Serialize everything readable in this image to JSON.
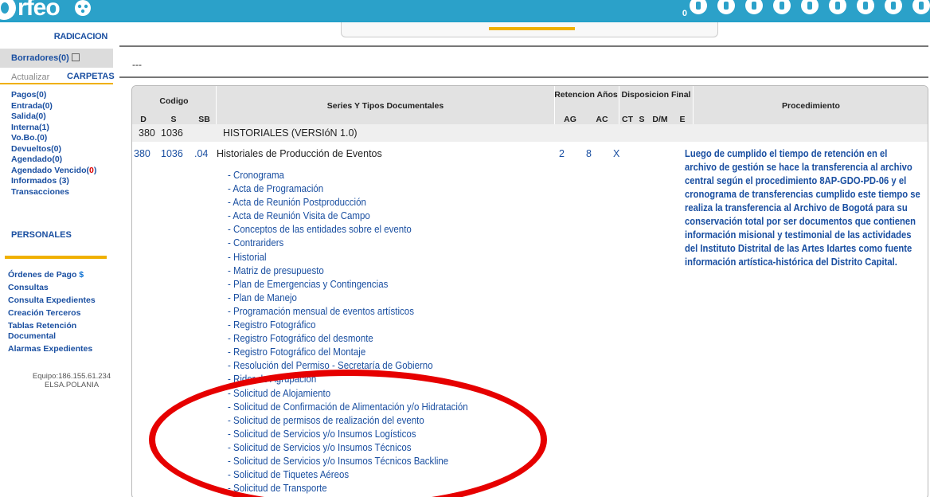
{
  "app": {
    "logo_text": "rfeo",
    "notification_count": "0"
  },
  "sidebar": {
    "radicacion": "RADICACION",
    "borradores": "Borradores(0)",
    "actualizar": "Actualizar",
    "carpetas": "CARPETAS",
    "folders": [
      "Pagos(0)",
      "Entrada(0)",
      "Salida(0)",
      "Interna(1)",
      "Vo.Bo.(0)",
      "Devueltos(0)",
      "Agendado(0)",
      "Agendado Vencido(",
      "Informados (3)",
      "Transacciones"
    ],
    "agendado_vencido_count": "0",
    "agendado_vencido_close": ")",
    "personales": "PERSONALES",
    "tools": [
      "Órdenes de Pago",
      "Consultas",
      "Consulta Expedientes",
      "Creación Terceros",
      "Tablas Retención Documental",
      "Alarmas Expedientes"
    ],
    "ordenes_symbol": "$",
    "equipo": "Equipo:186.155.61.234",
    "user": "ELSA.POLANIA"
  },
  "main": {
    "dashes": "---"
  },
  "table": {
    "headers": {
      "codigo": "Codigo",
      "d": "D",
      "s": "S",
      "sb": "SB",
      "series": "Series Y Tipos Documentales",
      "retencion": "Retencion Años",
      "ag": "AG",
      "ac": "AC",
      "disposicion": "Disposicion Final",
      "ct": "CT",
      "s2": "S",
      "dm": "D/M",
      "e": "E",
      "procedimiento": "Procedimiento"
    },
    "group": {
      "d": "380",
      "s": "1036",
      "name": "HISTORIALES (VERSIóN 1.0)"
    },
    "row": {
      "d": "380",
      "s": "1036",
      "sb": ".04",
      "name": "Historiales de Producción de Eventos",
      "ag": "2",
      "ac": "8",
      "ct": "X",
      "procedure": "Luego de cumplido el tiempo de retención en el archivo de gestión se hace la transferencia al archivo central según el procedimiento 8AP-GDO-PD-06 y el cronograma de transferencias cumplido este tiempo se realiza la transferencia al Archivo de Bogotá para su conservación total por ser documentos que contienen información misional y testimonial de las actividades del Instituto Distrital de las Artes Idartes como fuente información artística-histórica del Distrito Capital."
    },
    "document_types": [
      "- Cronograma",
      "- Acta de Programación",
      "- Acta de Reunión Postproducción",
      "- Acta de Reunión Visita de Campo",
      "- Conceptos de las entidades sobre el evento",
      "- Contrariders",
      "- Historial",
      "- Matriz de presupuesto",
      "- Plan de Emergencias y Contingencias",
      "- Plan de Manejo",
      "- Programación mensual de eventos artísticos",
      "- Registro Fotográfico",
      "- Registro Fotográfico del desmonte",
      "- Registro Fotográfico del Montaje",
      "- Resolución del Permiso - Secretaría de Gobierno",
      "- Rider de Agrupación",
      "- Solicitud de Alojamiento",
      "- Solicitud de Confirmación de Alimentación y/o Hidratación",
      "- Solicitud de permisos de realización del evento",
      "- Solicitud de Servicios y/o Insumos Logísticos",
      "- Solicitud de Servicios y/o Insumos Técnicos",
      "- Solicitud de Servicios y/o Insumos Técnicos Backline",
      "- Solicitud de Tiquetes Aéreos",
      "- Solicitud de Transporte"
    ]
  },
  "colors": {
    "topbar": "#2ba1c9",
    "link_blue": "#1a4fa1",
    "accent_orange": "#f0b000",
    "annotation_red": "#e60000"
  }
}
